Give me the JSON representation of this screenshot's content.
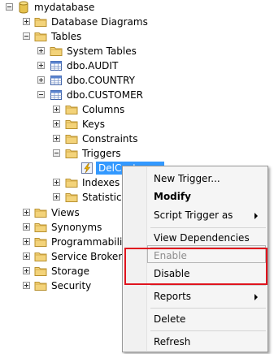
{
  "tree": {
    "root": "mydatabase",
    "database_diagrams": "Database Diagrams",
    "tables": "Tables",
    "system_tables": "System Tables",
    "table_audit": "dbo.AUDIT",
    "table_country": "dbo.COUNTRY",
    "table_customer": "dbo.CUSTOMER",
    "columns": "Columns",
    "keys": "Keys",
    "constraints": "Constraints",
    "triggers": "Triggers",
    "trigger_item": "DelCustomer",
    "indexes": "Indexes",
    "statistics": "Statistics",
    "views": "Views",
    "synonyms": "Synonyms",
    "programmability": "Programmability",
    "service_broker": "Service Broker",
    "storage": "Storage",
    "security": "Security"
  },
  "context_menu": {
    "new_trigger": "New Trigger...",
    "modify": "Modify",
    "script_trigger_as": "Script Trigger as",
    "view_dependencies": "View Dependencies",
    "enable": "Enable",
    "disable": "Disable",
    "reports": "Reports",
    "delete": "Delete",
    "refresh": "Refresh"
  },
  "colors": {
    "selection": "#3399ff",
    "highlight_box": "#e0141e",
    "folder": "#e8c25a"
  }
}
